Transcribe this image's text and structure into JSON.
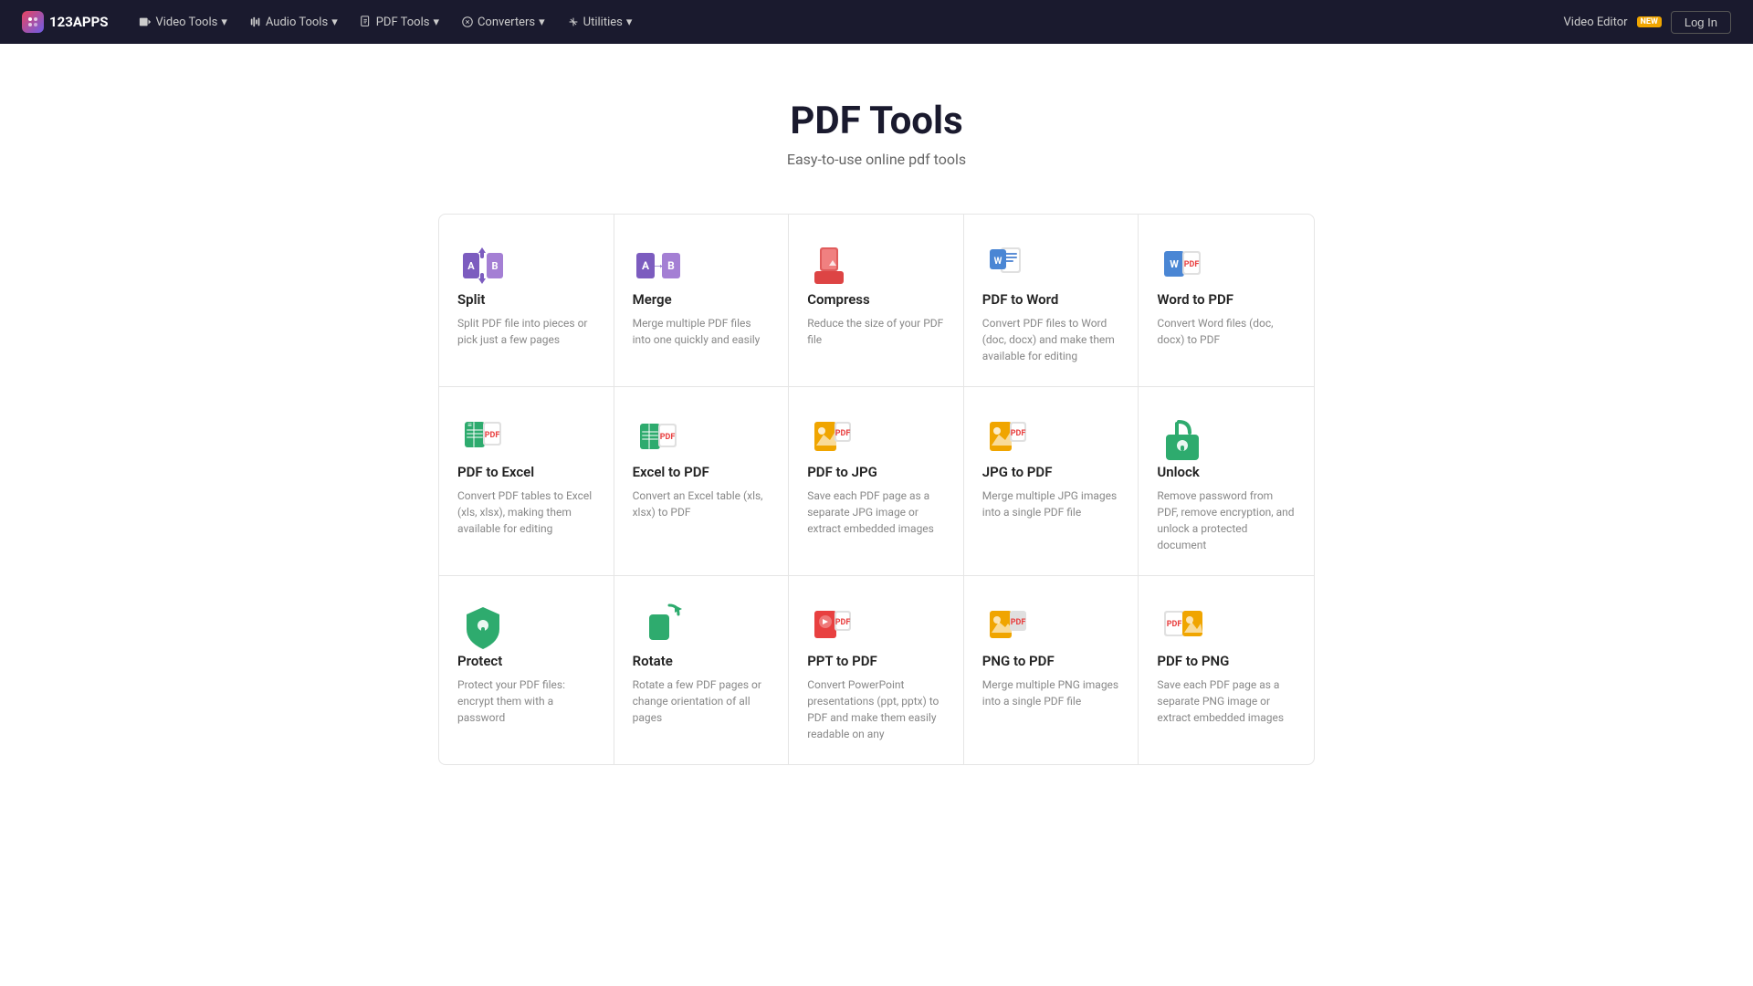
{
  "nav": {
    "logo": "123APPS",
    "menus": [
      {
        "label": "Video Tools",
        "icon": "video"
      },
      {
        "label": "Audio Tools",
        "icon": "audio"
      },
      {
        "label": "PDF Tools",
        "icon": "pdf"
      },
      {
        "label": "Converters",
        "icon": "converters"
      },
      {
        "label": "Utilities",
        "icon": "utilities"
      }
    ],
    "video_editor_label": "Video Editor",
    "new_badge": "NEW",
    "login_label": "Log In"
  },
  "hero": {
    "title": "PDF Tools",
    "subtitle": "Easy-to-use online pdf tools"
  },
  "tools": [
    {
      "name": "Split",
      "desc": "Split PDF file into pieces or pick just a few pages",
      "icon": "split"
    },
    {
      "name": "Merge",
      "desc": "Merge multiple PDF files into one quickly and easily",
      "icon": "merge"
    },
    {
      "name": "Compress",
      "desc": "Reduce the size of your PDF file",
      "icon": "compress"
    },
    {
      "name": "PDF to Word",
      "desc": "Convert PDF files to Word (doc, docx) and make them available for editing",
      "icon": "pdf-to-word"
    },
    {
      "name": "Word to PDF",
      "desc": "Convert Word files (doc, docx) to PDF",
      "icon": "word-to-pdf"
    },
    {
      "name": "PDF to Excel",
      "desc": "Convert PDF tables to Excel (xls, xlsx), making them available for editing",
      "icon": "pdf-to-excel"
    },
    {
      "name": "Excel to PDF",
      "desc": "Convert an Excel table (xls, xlsx) to PDF",
      "icon": "excel-to-pdf"
    },
    {
      "name": "PDF to JPG",
      "desc": "Save each PDF page as a separate JPG image or extract embedded images",
      "icon": "pdf-to-jpg"
    },
    {
      "name": "JPG to PDF",
      "desc": "Merge multiple JPG images into a single PDF file",
      "icon": "jpg-to-pdf"
    },
    {
      "name": "Unlock",
      "desc": "Remove password from PDF, remove encryption, and unlock a protected document",
      "icon": "unlock"
    },
    {
      "name": "Protect",
      "desc": "Protect your PDF files: encrypt them with a password",
      "icon": "protect"
    },
    {
      "name": "Rotate",
      "desc": "Rotate a few PDF pages or change orientation of all pages",
      "icon": "rotate"
    },
    {
      "name": "PPT to PDF",
      "desc": "Convert PowerPoint presentations (ppt, pptx) to PDF and make them easily readable on any",
      "icon": "ppt-to-pdf"
    },
    {
      "name": "PNG to PDF",
      "desc": "Merge multiple PNG images into a single PDF file",
      "icon": "png-to-pdf"
    },
    {
      "name": "PDF to PNG",
      "desc": "Save each PDF page as a separate PNG image or extract embedded images",
      "icon": "pdf-to-png"
    }
  ]
}
